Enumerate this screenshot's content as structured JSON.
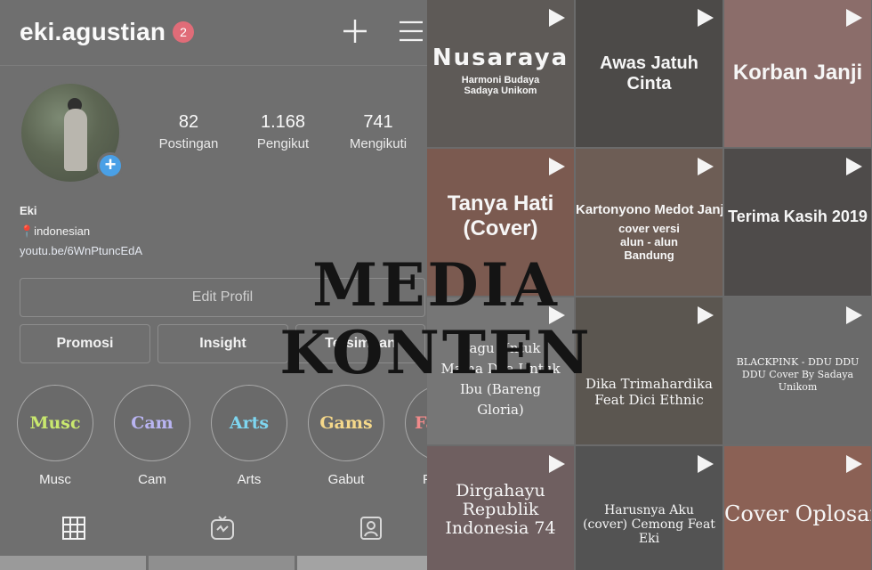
{
  "header": {
    "username": "eki.agustian",
    "notif_count": "2"
  },
  "stats": [
    {
      "value": "82",
      "label": "Postingan"
    },
    {
      "value": "1.168",
      "label": "Pengikut"
    },
    {
      "value": "741",
      "label": "Mengikuti"
    }
  ],
  "bio": {
    "name": "Eki",
    "location": "📍indonesian",
    "link": "youtu.be/6WnPtuncEdA"
  },
  "buttons": {
    "edit": "Edit Profil",
    "promosi": "Promosi",
    "insight": "Insight",
    "tersimpan": "Tersimpan"
  },
  "highlights": [
    {
      "inner": "Musc",
      "caption": "Musc",
      "color": "#c9e86e"
    },
    {
      "inner": "Cam",
      "caption": "Cam",
      "color": "#b9b4f2"
    },
    {
      "inner": "Arts",
      "caption": "Arts",
      "color": "#7ed6f0"
    },
    {
      "inner": "Gams",
      "caption": "Gabut",
      "color": "#f5d88a"
    },
    {
      "inner": "Fa",
      "caption": "F",
      "color": "#f08a8a"
    }
  ],
  "videos": [
    {
      "title": "Nusaraya",
      "subtitle": "Harmoni Budaya Sadaya Unikom"
    },
    {
      "title": "Awas Jatuh Cinta",
      "subtitle": ""
    },
    {
      "title": "Korban Janji",
      "subtitle": ""
    },
    {
      "title": "Tanya Hati (Cover)",
      "subtitle": ""
    },
    {
      "title": "Kartonyono Medot Janji",
      "subtitle": "cover versi alun - alun Bandung"
    },
    {
      "title": "Terima Kasih 2019",
      "subtitle": ""
    },
    {
      "title": "Lagu Untuk Mama Doa Untuk Ibu (Bareng Gloria)",
      "subtitle": ""
    },
    {
      "title": "Dika Trimahardika Feat Dici Ethnic",
      "subtitle": ""
    },
    {
      "title": "BLACKPINK - DDU DDU DDU Cover By Sadaya Unikom",
      "subtitle": ""
    },
    {
      "title": "Dirgahayu Republik Indonesia 74",
      "subtitle": ""
    },
    {
      "title": "Harusnya Aku (cover) Cemong Feat Eki",
      "subtitle": ""
    },
    {
      "title": "Cover Oplosan",
      "subtitle": ""
    }
  ],
  "banner": "MEDIA KONTEN"
}
